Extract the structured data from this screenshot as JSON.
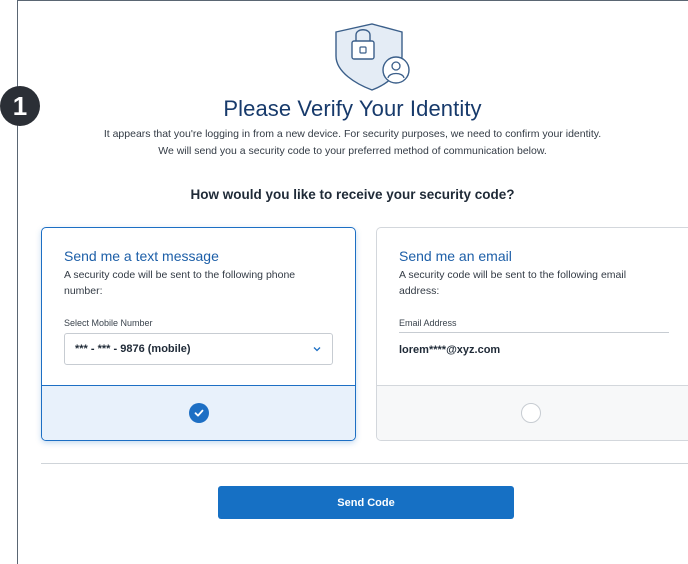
{
  "step_badge": "1",
  "header": {
    "title": "Please Verify Your Identity",
    "description_line1": "It appears that you're logging in from a new device. For security purposes, we need to confirm your identity.",
    "description_line2": "We will send you a security code to your preferred method of communication below.",
    "icon": "shield-lock-user-icon"
  },
  "question": "How would you like to receive your security code?",
  "options": {
    "text": {
      "title": "Send me a text message",
      "description": "A security code will be sent to the following phone number:",
      "field_label": "Select Mobile Number",
      "selected_value": "*** - *** - 9876 (mobile)",
      "selected": true
    },
    "email": {
      "title": "Send me an email",
      "description": "A security code will be sent to the following email address:",
      "field_label": "Email Address",
      "value": "lorem****@xyz.com",
      "selected": false
    }
  },
  "send_button_label": "Send Code",
  "colors": {
    "accent": "#1670c4",
    "title": "#173a6b",
    "selected_bg": "#e8f1fb"
  }
}
